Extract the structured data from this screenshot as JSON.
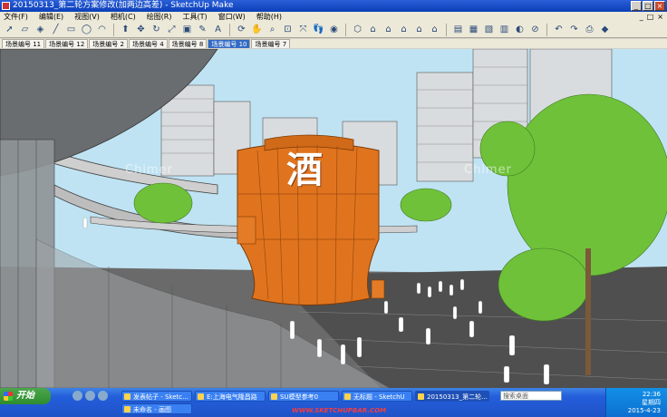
{
  "window": {
    "title": "20150313_第二轮方案修改(加两边高差) - SketchUp Make",
    "controls": [
      "_",
      "□",
      "×"
    ]
  },
  "menubar": {
    "items": [
      "文件(F)",
      "编辑(E)",
      "视图(V)",
      "相机(C)",
      "绘图(R)",
      "工具(T)",
      "窗口(W)",
      "帮助(H)"
    ],
    "mdi_controls": [
      "_",
      "□",
      "×"
    ]
  },
  "toolbar": {
    "icons": [
      "select-icon",
      "eraser-icon",
      "paint-icon",
      "line-icon",
      "rectangle-icon",
      "circle-icon",
      "arc-icon",
      "pushpull-icon",
      "move-icon",
      "rotate-icon",
      "scale-icon",
      "offset-icon",
      "tape-icon",
      "text-icon",
      "axes-icon",
      "orbit-icon",
      "pan-icon",
      "zoom-icon",
      "zoom-window-icon",
      "zoom-extents-icon",
      "walk-icon",
      "look-icon",
      "position-camera-icon",
      "section-icon",
      "iso-icon",
      "top-icon",
      "front-icon",
      "right-icon",
      "back-icon",
      "left-icon",
      "warehouse-icon",
      "share-icon",
      "components-icon",
      "styles-icon",
      "layers-icon",
      "shadows-icon",
      "fog-icon",
      "outliner-icon",
      "undo-icon",
      "redo-icon",
      "print-icon",
      "model-info-icon"
    ]
  },
  "scene_tabs": [
    {
      "label": "场景编号 11",
      "active": false
    },
    {
      "label": "场景编号 12",
      "active": false
    },
    {
      "label": "场景编号 2",
      "active": false
    },
    {
      "label": "场景编号 4",
      "active": false
    },
    {
      "label": "场景编号 8",
      "active": false
    },
    {
      "label": "场景编号 10",
      "active": true
    },
    {
      "label": "场景编号 7",
      "active": false
    }
  ],
  "viewport": {
    "sign_text": "酒",
    "watermark": "Chimer",
    "colors": {
      "sky": "#bfe3f3",
      "barrel": "#e0741e",
      "ground": "#5a5a5a",
      "tree": "#6fc13a"
    }
  },
  "taskbar": {
    "start_label": "开始",
    "tasks": [
      {
        "label": "发表帖子 - Sketc...",
        "active": false
      },
      {
        "label": "E:上海电气隆昌路",
        "active": false
      },
      {
        "label": "SU模型参考0",
        "active": false
      },
      {
        "label": "无标题 - SketchU",
        "active": false
      },
      {
        "label": "20150313_第二轮...",
        "active": true
      },
      {
        "label": "未命名 - 画图",
        "active": false
      }
    ],
    "search_placeholder": "搜索桌面",
    "footer_link": "WWW.SKETCHUPBAR.COM",
    "clock_time": "22:36",
    "clock_day": "星期四",
    "clock_date": "2015-4-23"
  }
}
